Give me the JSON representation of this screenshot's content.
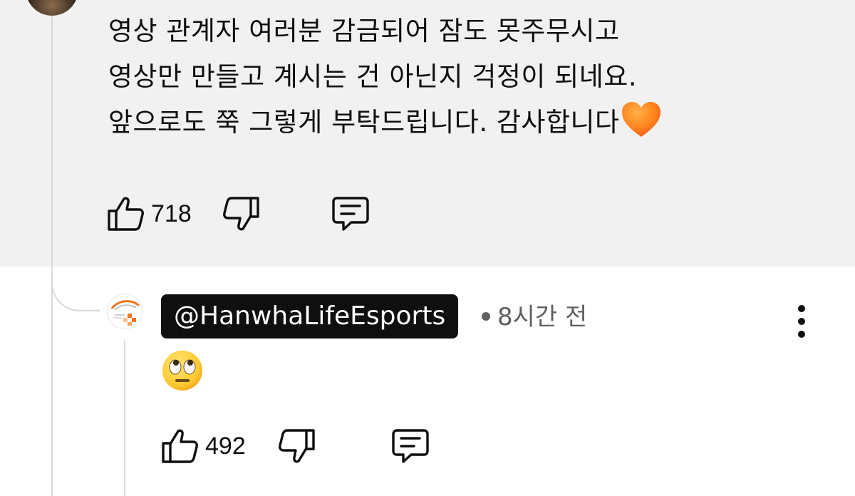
{
  "parent_comment": {
    "lines": [
      "영상 관계자 여러분 감금되어 잠도 못주무시고",
      "영상만 만들고 계시는 건 아닌지 걱정이 되네요.",
      "앞으로도 쭉 그렇게 부탁드립니다. 감사합니다"
    ],
    "emoji": "orange-heart-emoji",
    "likes": "718",
    "icons": {
      "like": "thumbs-up-icon",
      "dislike": "thumbs-down-icon",
      "reply": "comment-icon"
    }
  },
  "reply": {
    "author": "@HanwhaLifeEsports",
    "time": "8시간 전",
    "emoji": "face-with-rolling-eyes-emoji",
    "likes": "492",
    "icons": {
      "avatar": "hanwha-life-esports-logo",
      "menu": "more-vert-icon"
    }
  },
  "colors": {
    "highlight_bg": "#f1f1f1",
    "text": "#0f0f0f",
    "meta": "#606060",
    "thread_line": "#d9d9d9",
    "chip_bg": "#0f0f0f",
    "brand_orange": "#f37321"
  }
}
